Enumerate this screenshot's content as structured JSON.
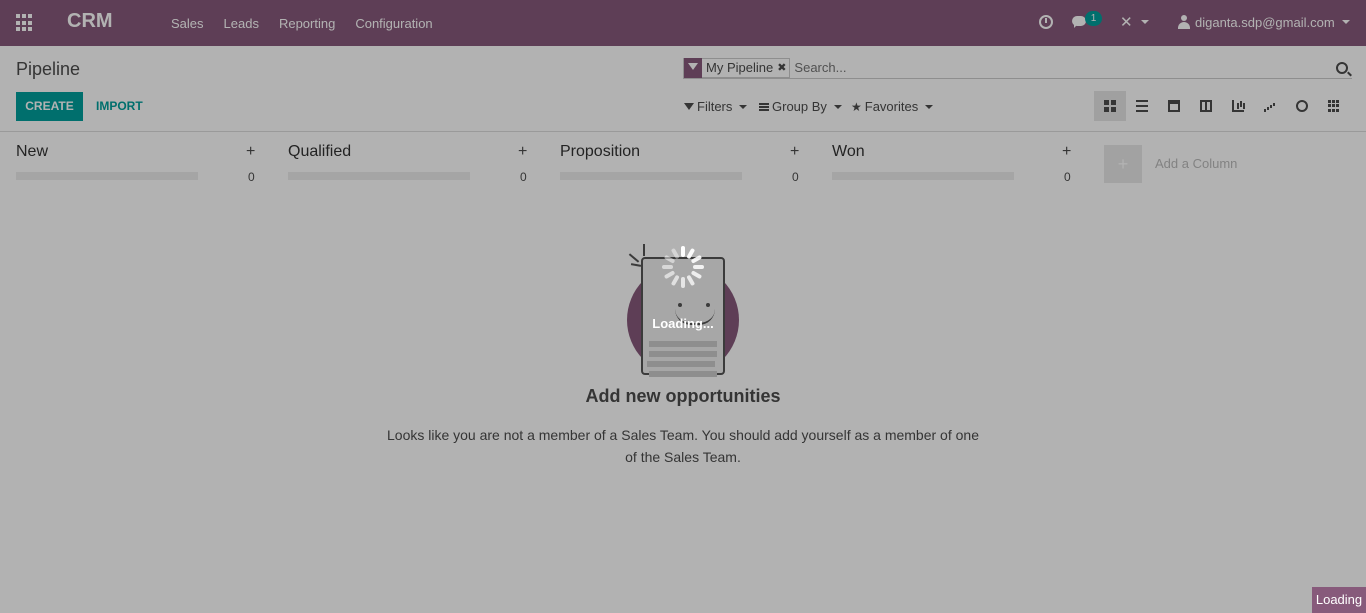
{
  "navbar": {
    "brand": "CRM",
    "menu": [
      "Sales",
      "Leads",
      "Reporting",
      "Configuration"
    ],
    "chat_badge": "1",
    "user": "diganta.sdp@gmail.com"
  },
  "control_panel": {
    "breadcrumb": "Pipeline",
    "search": {
      "facet_label": "My Pipeline",
      "placeholder": "Search..."
    },
    "create_label": "CREATE",
    "import_label": "IMPORT",
    "filters_label": "Filters",
    "groupby_label": "Group By",
    "favorites_label": "Favorites",
    "views": [
      "kanban",
      "list",
      "calendar",
      "pivot",
      "graph",
      "cohort",
      "dashboard",
      "grid"
    ],
    "active_view": "kanban"
  },
  "kanban": {
    "columns": [
      {
        "title": "New",
        "count": "0"
      },
      {
        "title": "Qualified",
        "count": "0"
      },
      {
        "title": "Proposition",
        "count": "0"
      },
      {
        "title": "Won",
        "count": "0"
      }
    ],
    "add_column_label": "Add a Column"
  },
  "empty_state": {
    "title": "Add new opportunities",
    "description": "Looks like you are not a member of a Sales Team. You should add yourself as a member of one of the Sales Team."
  },
  "loading": {
    "center_text": "Loading...",
    "corner_text": "Loading"
  },
  "colors": {
    "brand": "#875A7B",
    "accent": "#00A09D"
  }
}
